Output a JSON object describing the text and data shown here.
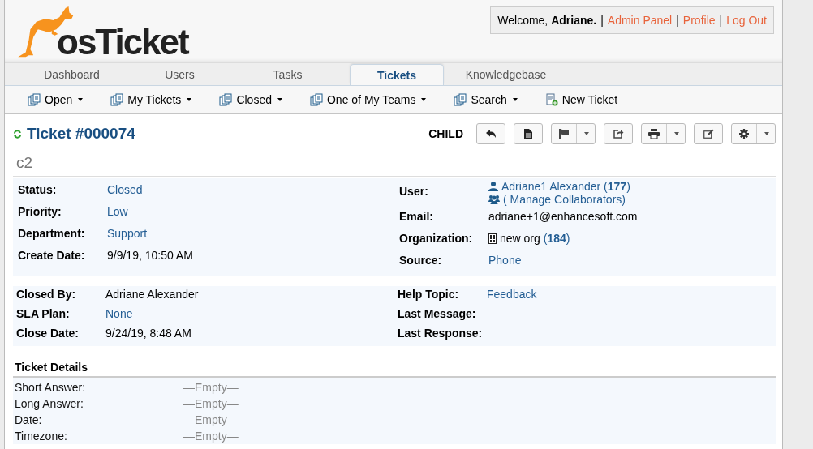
{
  "logo": {
    "text": "osTicket"
  },
  "welcome": {
    "greeting": "Welcome,",
    "name": "Adriane.",
    "links": [
      {
        "separator": "|",
        "label": "Admin Panel"
      },
      {
        "separator": "|",
        "label": "Profile"
      },
      {
        "separator": "|",
        "label": "Log Out"
      }
    ]
  },
  "nav_tabs": [
    {
      "label": "Dashboard",
      "selected": false
    },
    {
      "label": "Users",
      "selected": false
    },
    {
      "label": "Tasks",
      "selected": false
    },
    {
      "label": "Tickets",
      "selected": true
    },
    {
      "label": "Knowledgebase",
      "selected": false
    }
  ],
  "sub_menu": [
    {
      "label": "Open",
      "kind": "queue",
      "dropdown": true
    },
    {
      "label": "My Tickets",
      "kind": "queue",
      "dropdown": true
    },
    {
      "label": "Closed",
      "kind": "queue",
      "dropdown": true
    },
    {
      "label": "One of My Teams",
      "kind": "queue",
      "dropdown": true
    },
    {
      "label": "Search",
      "kind": "queue",
      "dropdown": true
    },
    {
      "label": "New Ticket",
      "kind": "new",
      "dropdown": false
    }
  ],
  "ticket": {
    "title": "Ticket #000074",
    "relation": "CHILD",
    "subject": "c2"
  },
  "actions": [
    {
      "kind": "reply",
      "dropdown": false
    },
    {
      "kind": "note",
      "dropdown": false
    },
    {
      "kind": "flag",
      "dropdown": true
    },
    {
      "kind": "share",
      "dropdown": false
    },
    {
      "kind": "print",
      "dropdown": true
    },
    {
      "kind": "edit",
      "dropdown": false
    },
    {
      "kind": "settings",
      "dropdown": true
    }
  ],
  "info_left": [
    {
      "label": "Status:",
      "value": "Closed",
      "link": true
    },
    {
      "label": "Priority:",
      "value": "Low",
      "link": true
    },
    {
      "label": "Department:",
      "value": "Support",
      "link": true
    },
    {
      "label": "Create Date:",
      "value": "9/9/19, 10:50 AM",
      "link": false
    }
  ],
  "info_right": {
    "user": {
      "label": "User:",
      "name": "Adriane1 Alexander (**177**)",
      "collaborators": "( Manage Collaborators)"
    },
    "email": {
      "label": "Email:",
      "value": "adriane+1@enhancesoft.com"
    },
    "organization": {
      "label": "Organization:",
      "name": "new org",
      "count": "(**184**)"
    },
    "source": {
      "label": "Source:",
      "value": "Phone"
    }
  },
  "closure_left": [
    {
      "label": "Closed By:",
      "value": "Adriane Alexander",
      "link": false
    },
    {
      "label": "SLA Plan:",
      "value": "None",
      "link": true
    },
    {
      "label": "Close Date:",
      "value": "9/24/19, 8:48 AM",
      "link": false
    }
  ],
  "closure_right": [
    {
      "label": "Help Topic:",
      "value": "Feedback",
      "link": true
    },
    {
      "label": "Last Message:"
    },
    {
      "label": "Last Response:"
    }
  ],
  "details": {
    "title": "Ticket Details",
    "rows": [
      {
        "label": "Short Answer:",
        "value": "—Empty—"
      },
      {
        "label": "Long Answer:",
        "value": "—Empty—"
      },
      {
        "label": "Date:",
        "value": "—Empty—"
      },
      {
        "label": "Timezone:",
        "value": "—Empty—"
      }
    ]
  }
}
